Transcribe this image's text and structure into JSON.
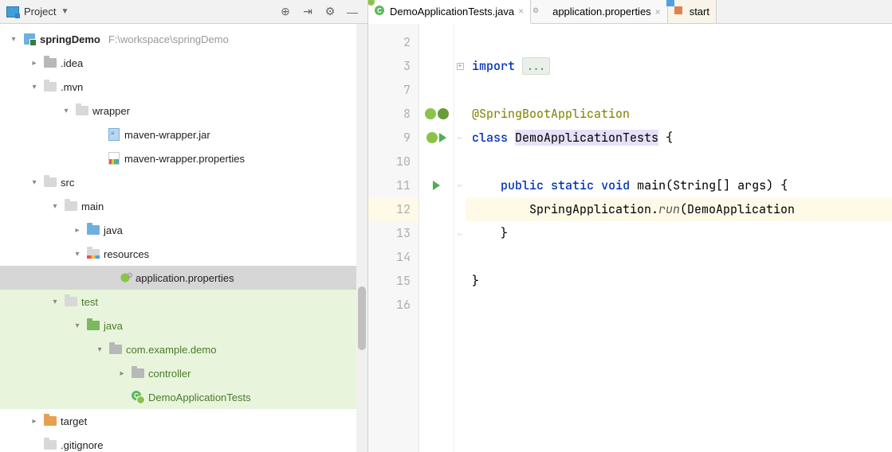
{
  "sidebar": {
    "header": {
      "label": "Project"
    },
    "root": {
      "name": "springDemo",
      "path": "F:\\workspace\\springDemo"
    },
    "nodes": [
      {
        "label": ".idea",
        "indent": 36,
        "chev": "right",
        "icon": "folder.darker"
      },
      {
        "label": ".mvn",
        "indent": 36,
        "chev": "down",
        "icon": "folder"
      },
      {
        "label": "wrapper",
        "indent": 76,
        "chev": "down",
        "icon": "folder"
      },
      {
        "label": "maven-wrapper.jar",
        "indent": 116,
        "chev": "blank",
        "icon": "jar"
      },
      {
        "label": "maven-wrapper.properties",
        "indent": 116,
        "chev": "blank",
        "icon": "props"
      },
      {
        "label": "src",
        "indent": 36,
        "chev": "down",
        "icon": "folder"
      },
      {
        "label": "main",
        "indent": 62,
        "chev": "down",
        "icon": "folder"
      },
      {
        "label": "java",
        "indent": 90,
        "chev": "right",
        "icon": "folder.blue"
      },
      {
        "label": "resources",
        "indent": 90,
        "chev": "down",
        "icon": "folder.resources"
      },
      {
        "label": "application.properties",
        "indent": 130,
        "chev": "blank",
        "icon": "props-spring",
        "selected": true
      },
      {
        "label": "test",
        "indent": 62,
        "chev": "down",
        "icon": "folder",
        "green": true
      },
      {
        "label": "java",
        "indent": 90,
        "chev": "down",
        "icon": "folder.green",
        "green": true
      },
      {
        "label": "com.example.demo",
        "indent": 118,
        "chev": "down",
        "icon": "folder.darker",
        "green": true
      },
      {
        "label": "controller",
        "indent": 146,
        "chev": "right",
        "icon": "folder.darker",
        "green": true
      },
      {
        "label": "DemoApplicationTests",
        "indent": 146,
        "chev": "blank",
        "icon": "class-spring",
        "green": true
      },
      {
        "label": "target",
        "indent": 36,
        "chev": "right",
        "icon": "folder.orange"
      },
      {
        "label": ".gitignore",
        "indent": 36,
        "chev": "blank",
        "icon": "file",
        "cut": true
      }
    ]
  },
  "tabs": [
    {
      "label": "DemoApplicationTests.java",
      "icon": "spring-class",
      "active": true
    },
    {
      "label": "application.properties",
      "icon": "spring-leaf"
    },
    {
      "label": "start",
      "icon": "stack",
      "partial": true
    }
  ],
  "gutter_lines": [
    "2",
    "3",
    "7",
    "8",
    "9",
    "10",
    "11",
    "12",
    "13",
    "14",
    "15",
    "16"
  ],
  "current_line_idx": 7,
  "code": {
    "import_kw": "import",
    "import_fold": "...",
    "annotation": "@SpringBootApplication",
    "class_kw": "class",
    "class_name": "DemoApplicationTests",
    "open_brace": " {",
    "main_sig_pre": "    ",
    "main_public": "public",
    "main_static": "static",
    "main_void": "void",
    "main_rest": " main(String[] args) {",
    "run_indent": "        SpringApplication.",
    "run_method": "run",
    "run_args": "(DemoApplication",
    "close_inner": "    }",
    "close_outer": "}"
  }
}
